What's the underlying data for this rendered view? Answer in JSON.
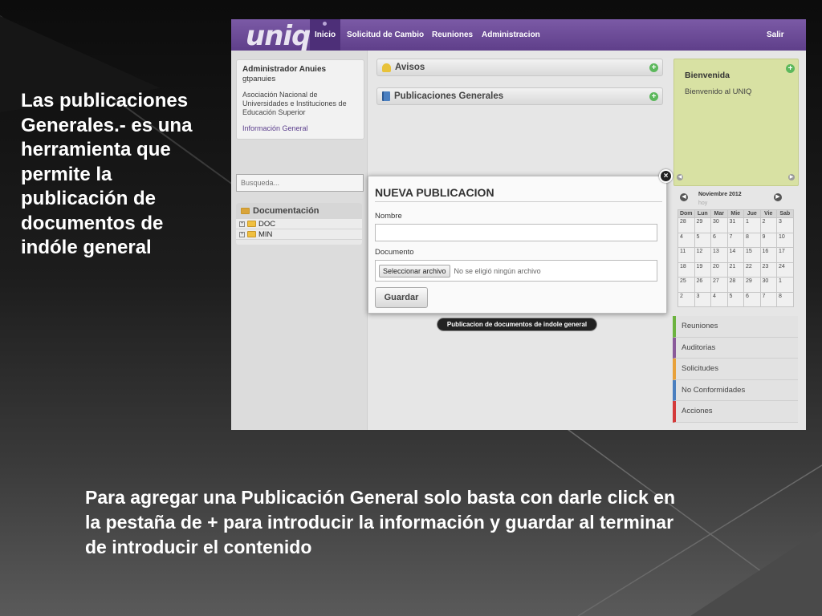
{
  "slide": {
    "left_text": "Las publicaciones Generales.- es una herramienta que permite la publicación de documentos de indóle general",
    "bottom_text": "Para agregar una Publicación General solo basta con darle click en la pestaña de + para introducir la información y guardar al terminar de introducir el contenido"
  },
  "app": {
    "logo": "uniq",
    "nav": [
      "Inicio",
      "Solicitud de Cambio",
      "Reuniones",
      "Administracion"
    ],
    "logout": "Salir",
    "user": {
      "name": "Administrador Anuies",
      "login": "gtpanuies",
      "org": "Asociación Nacional de Universidades e Instituciones de Educación Superior",
      "link": "Información General"
    },
    "search_placeholder": "Busqueda...",
    "docs": {
      "title": "Documentación",
      "items": [
        "DOC",
        "MIN"
      ]
    },
    "panels": {
      "avisos": "Avisos",
      "publicaciones": "Publicaciones Generales",
      "add_symbol": "+"
    },
    "welcome": {
      "title": "Bienvenida",
      "text": "Bienvenido al UNIQ"
    },
    "calendar": {
      "month": "Noviembre 2012",
      "today": "hoy",
      "prev": "◀",
      "next": "▶",
      "weekdays": [
        "Dom",
        "Lun",
        "Mar",
        "Mie",
        "Jue",
        "Vie",
        "Sab"
      ],
      "weeks": [
        [
          "28",
          "29",
          "30",
          "31",
          "1",
          "2",
          "3"
        ],
        [
          "4",
          "5",
          "6",
          "7",
          "8",
          "9",
          "10"
        ],
        [
          "11",
          "12",
          "13",
          "14",
          "15",
          "16",
          "17"
        ],
        [
          "18",
          "19",
          "20",
          "21",
          "22",
          "23",
          "24"
        ],
        [
          "25",
          "26",
          "27",
          "28",
          "29",
          "30",
          "1"
        ],
        [
          "2",
          "3",
          "4",
          "5",
          "6",
          "7",
          "8"
        ]
      ]
    },
    "side_menu": [
      {
        "label": "Reuniones",
        "color": "#6cb33f"
      },
      {
        "label": "Auditorias",
        "color": "#8a5a9a"
      },
      {
        "label": "Solicitudes",
        "color": "#e8a13a"
      },
      {
        "label": "No Conformidades",
        "color": "#4a7fc0"
      },
      {
        "label": "Acciones",
        "color": "#d43a3a"
      }
    ],
    "modal": {
      "title": "NUEVA PUBLICACION",
      "name_label": "Nombre",
      "doc_label": "Documento",
      "file_button": "Seleccionar archivo",
      "file_status": "No se eligió ningún archivo",
      "save": "Guardar",
      "close": "×"
    },
    "tooltip": "Publicacion de documentos de indole general"
  },
  "colors": {
    "topbar": "#6a4a96",
    "active_nav": "#4d2f78",
    "welcome_bg": "#d8e1a3",
    "add_green": "#5cb85c"
  }
}
